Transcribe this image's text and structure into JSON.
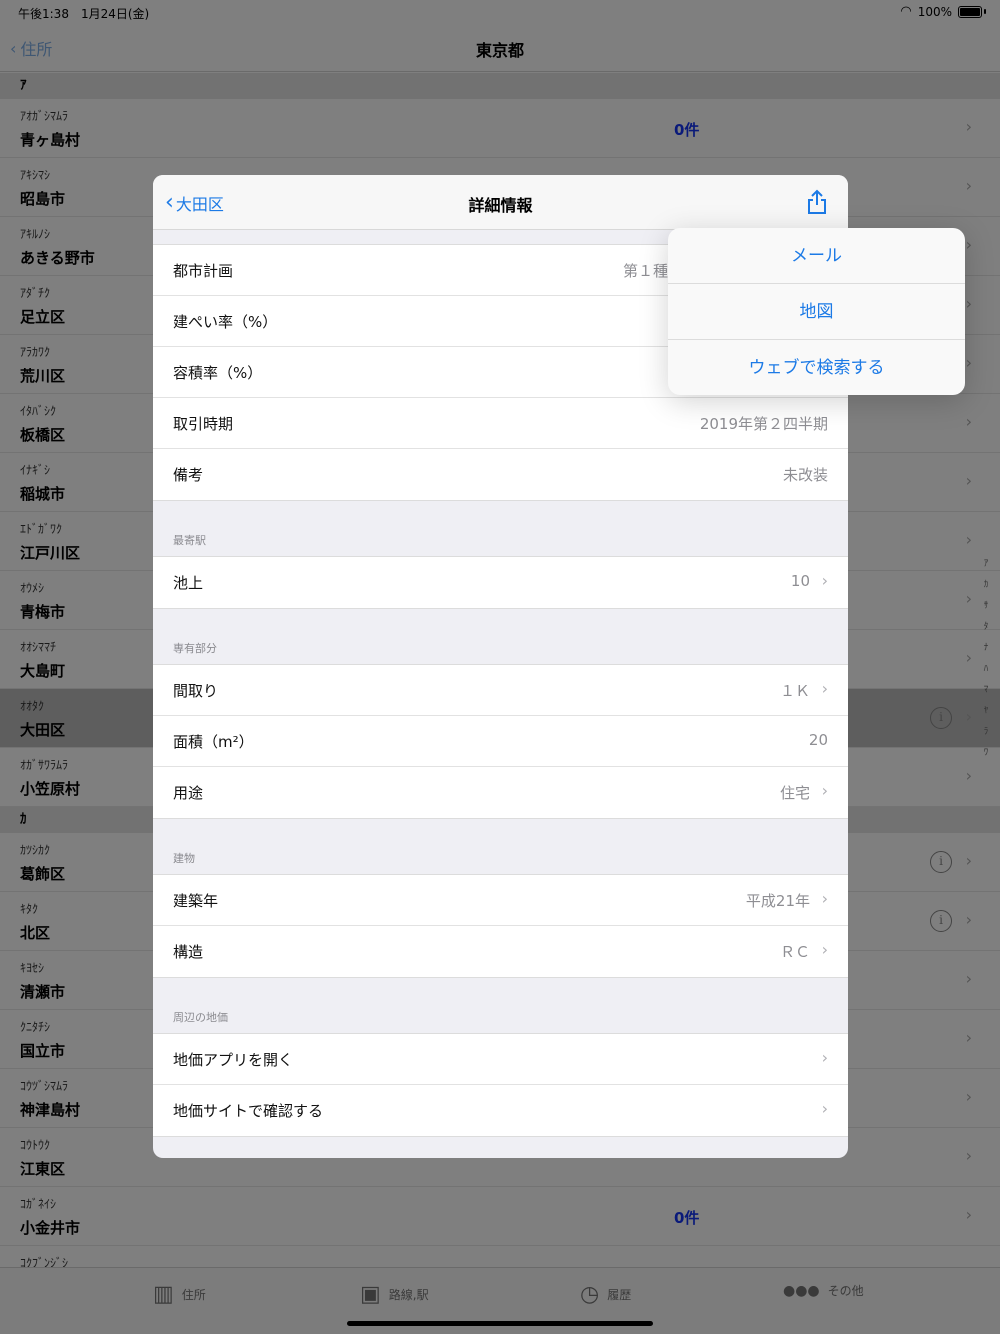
{
  "status": {
    "time": "午後1:38　1月24日(金)",
    "battery": "100%"
  },
  "nav": {
    "back": "住所",
    "title": "東京都"
  },
  "list": {
    "sections": [
      {
        "header": "ｱ",
        "rows": [
          {
            "kana": "ｱｵｶﾞｼﾏﾑﾗ",
            "name": "青ヶ島村",
            "count": "0件"
          },
          {
            "kana": "ｱｷｼﾏｼ",
            "name": "昭島市"
          },
          {
            "kana": "ｱｷﾙﾉｼ",
            "name": "あきる野市"
          },
          {
            "kana": "ｱﾀﾞﾁｸ",
            "name": "足立区"
          },
          {
            "kana": "ｱﾗｶﾜｸ",
            "name": "荒川区"
          },
          {
            "kana": "ｲﾀﾊﾞｼｸ",
            "name": "板橋区"
          },
          {
            "kana": "ｲﾅｷﾞｼ",
            "name": "稲城市"
          },
          {
            "kana": "ｴﾄﾞｶﾞﾜｸ",
            "name": "江戸川区"
          },
          {
            "kana": "ｵｳﾒｼ",
            "name": "青梅市"
          },
          {
            "kana": "ｵｵｼﾏﾏﾁ",
            "name": "大島町"
          },
          {
            "kana": "ｵｵﾀｸ",
            "name": "大田区"
          },
          {
            "kana": "ｵｶﾞｻﾜﾗﾑﾗ",
            "name": "小笠原村"
          }
        ]
      },
      {
        "header": "ｶ",
        "rows": [
          {
            "kana": "ｶﾂｼｶｸ",
            "name": "葛飾区"
          },
          {
            "kana": "ｷﾀｸ",
            "name": "北区"
          },
          {
            "kana": "ｷﾖｾｼ",
            "name": "清瀬市"
          },
          {
            "kana": "ｸﾆﾀﾁｼ",
            "name": "国立市"
          },
          {
            "kana": "ｺｳﾂﾞｼﾏﾑﾗ",
            "name": "神津島村"
          },
          {
            "kana": "ｺｳﾄｳｸ",
            "name": "江東区"
          },
          {
            "kana": "ｺｶﾞﾈｲｼ",
            "name": "小金井市",
            "count": "0件"
          },
          {
            "kana": "ｺｸﾌﾞﾝｼﾞｼ",
            "name": ""
          }
        ]
      }
    ],
    "index": [
      "ｱ",
      "ｶ",
      "ｻ",
      "ﾀ",
      "ﾅ",
      "ﾊ",
      "ﾏ",
      "ﾔ",
      "ﾗ",
      "ﾜ"
    ]
  },
  "modal": {
    "back": "大田区",
    "title": "詳細情報",
    "group1": [
      {
        "label": "都市計画",
        "value": "第１種"
      },
      {
        "label": "建ぺい率（%）",
        "value": ""
      },
      {
        "label": "容積率（%）",
        "value": ""
      },
      {
        "label": "取引時期",
        "value": "2019年第２四半期"
      },
      {
        "label": "備考",
        "value": "未改装"
      }
    ],
    "station_header": "最寄駅",
    "station": [
      {
        "label": "池上",
        "value": "10"
      }
    ],
    "private_header": "専有部分",
    "private": [
      {
        "label": "間取り",
        "value": "１Ｋ"
      },
      {
        "label": "面積（m²）",
        "value": "20"
      },
      {
        "label": "用途",
        "value": "住宅"
      }
    ],
    "building_header": "建物",
    "building": [
      {
        "label": "建築年",
        "value": "平成21年"
      },
      {
        "label": "構造",
        "value": "ＲＣ"
      }
    ],
    "land_header": "周辺の地価",
    "land": [
      {
        "label": "地価アプリを開く"
      },
      {
        "label": "地価サイトで確認する"
      }
    ]
  },
  "popover": {
    "items": [
      "メール",
      "地図",
      "ウェブで検索する"
    ]
  },
  "tabs": [
    {
      "label": "住所",
      "icon": "building-icon"
    },
    {
      "label": "路線,駅",
      "icon": "train-icon"
    },
    {
      "label": "履歴",
      "icon": "clock-icon"
    },
    {
      "label": "その他",
      "icon": "more-icon"
    }
  ],
  "colors": {
    "accent": "#1c7ae6",
    "count": "#0a1a7a"
  }
}
